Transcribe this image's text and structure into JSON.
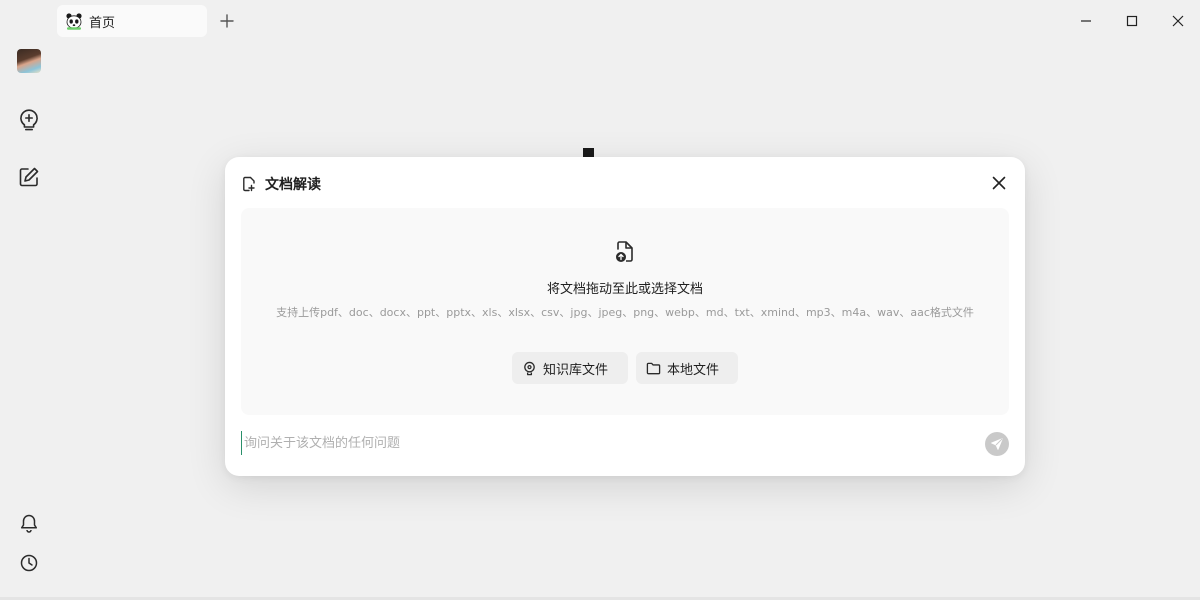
{
  "tabs": [
    {
      "label": "首页",
      "icon": "panda-icon"
    }
  ],
  "window_controls": [
    "minimize-icon",
    "maximize-icon",
    "close-icon"
  ],
  "sidebar": {
    "items": [
      {
        "icon": "avatar"
      },
      {
        "icon": "lightbulb-plus-icon"
      },
      {
        "icon": "edit-icon"
      },
      {
        "icon": "bell-icon"
      },
      {
        "icon": "clock-icon"
      }
    ]
  },
  "modal": {
    "title": "文档解读",
    "upload": {
      "title": "将文档拖动至此或选择文档",
      "hint": "支持上传pdf、doc、docx、ppt、pptx、xls、xlsx、csv、jpg、jpeg、png、webp、md、txt、xmind、mp3、m4a、wav、aac格式文件"
    },
    "buttons": {
      "knowledge_base": "知识库文件",
      "local": "本地文件"
    },
    "input": {
      "placeholder": "询问关于该文档的任何问题",
      "value": ""
    }
  },
  "colors": {
    "background": "#f0f0f0",
    "modal": "#ffffff",
    "dropzone": "#f9f9f9",
    "button": "#eeeeee",
    "send_disabled": "#c9c9c9",
    "caret": "#2a8f6a"
  }
}
